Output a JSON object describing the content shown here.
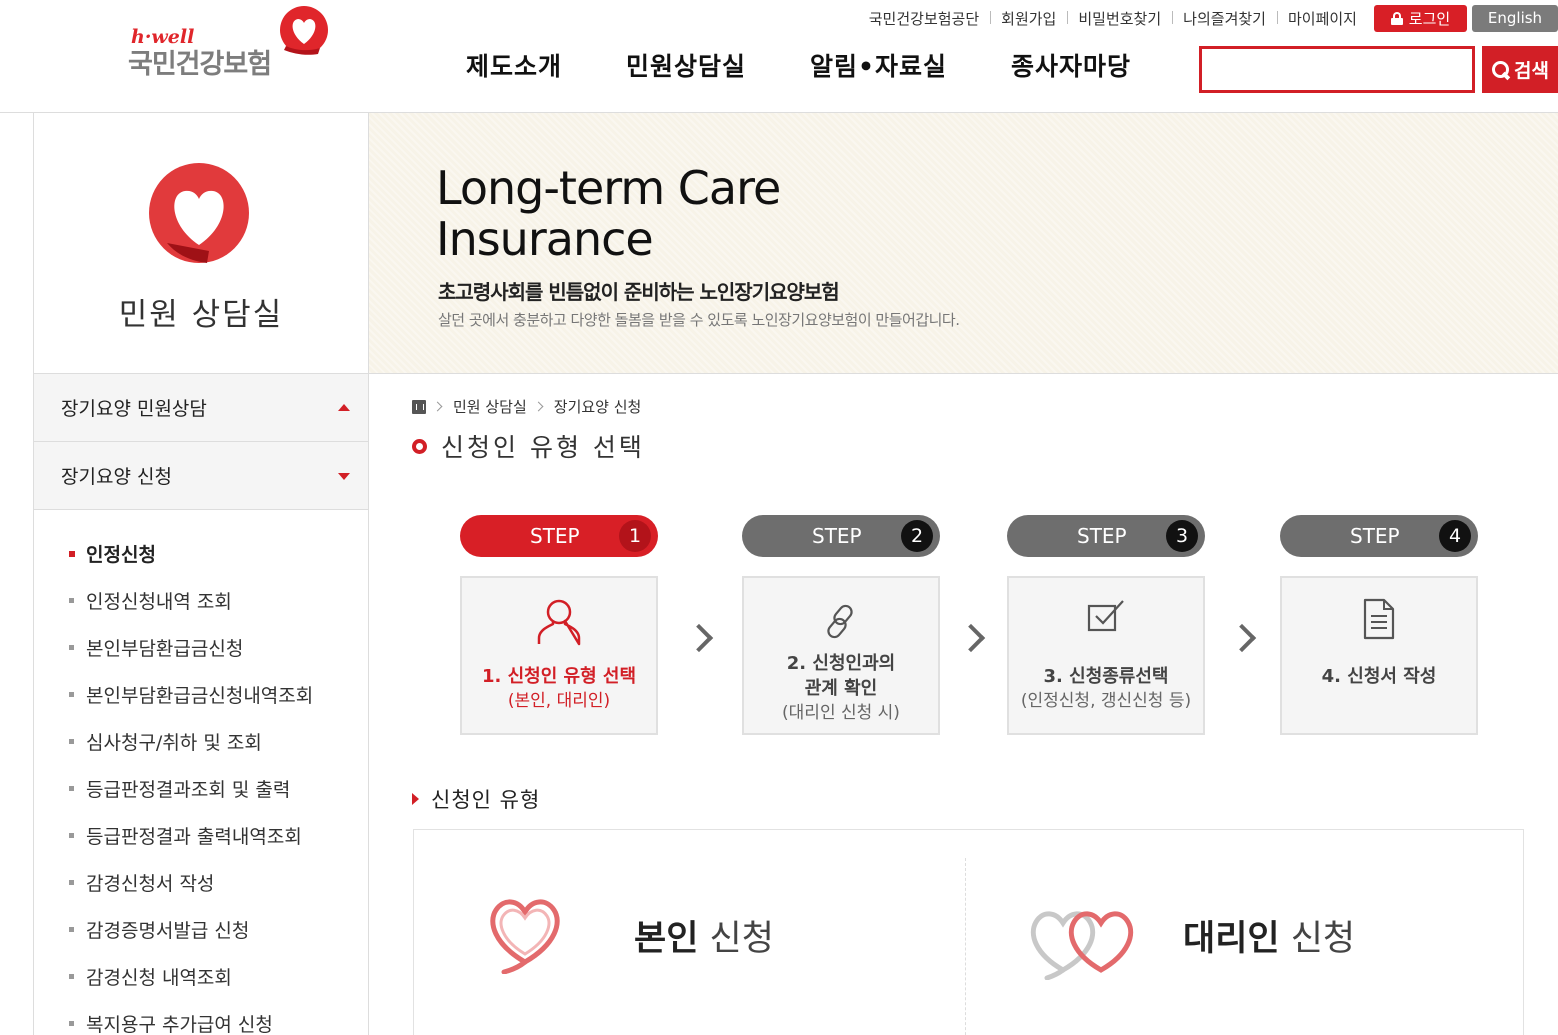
{
  "header": {
    "logo_brand": "h·well",
    "logo_name": "국민건강보험",
    "util_links": [
      "국민건강보험공단",
      "회원가입",
      "비밀번호찾기",
      "나의즐겨찾기",
      "마이페이지"
    ],
    "login_label": "로그인",
    "english_label": "English",
    "gnb": [
      "제도소개",
      "민원상담실",
      "알림•자료실",
      "종사자마당"
    ],
    "search_value": "",
    "search_label": "검색"
  },
  "sidebar": {
    "title": "민원 상담실",
    "menus": [
      {
        "label": "장기요양 민원상담",
        "state": "collapsed"
      },
      {
        "label": "장기요양 신청",
        "state": "expanded"
      }
    ],
    "sub_items": [
      {
        "label": "인정신청",
        "active": true
      },
      {
        "label": "인정신청내역 조회"
      },
      {
        "label": "본인부담환급금신청"
      },
      {
        "label": "본인부담환급금신청내역조회"
      },
      {
        "label": "심사청구/취하 및 조회"
      },
      {
        "label": "등급판정결과조회 및 출력"
      },
      {
        "label": "등급판정결과 출력내역조회"
      },
      {
        "label": "감경신청서 작성"
      },
      {
        "label": "감경증명서발급 신청"
      },
      {
        "label": "감경신청 내역조회"
      },
      {
        "label": "복지용구 추가급여 신청"
      }
    ]
  },
  "banner": {
    "title_line1": "Long-term Care",
    "title_line2": "Insurance",
    "subtitle": "초고령사회를 빈틈없이 준비하는 노인장기요양보험",
    "description": "살던 곳에서 충분하고 다양한 돌봄을 받을 수 있도록 노인장기요양보험이 만들어갑니다."
  },
  "breadcrumb": [
    "민원 상담실",
    "장기요양 신청"
  ],
  "page_title": "신청인 유형 선택",
  "steps": [
    {
      "label": "STEP",
      "num": "1",
      "line1": "1. 신청인 유형 선택",
      "line2": "(본인, 대리인)",
      "active": true,
      "icon": "person-icon"
    },
    {
      "label": "STEP",
      "num": "2",
      "line1a": "2. 신청인과의",
      "line1b": "관계 확인",
      "line2": "(대리인 신청 시)",
      "icon": "link-icon"
    },
    {
      "label": "STEP",
      "num": "3",
      "line1": "3. 신청종류선택",
      "line2": "(인정신청, 갱신신청 등)",
      "icon": "checkbox-icon"
    },
    {
      "label": "STEP",
      "num": "4",
      "line1": "4. 신청서 작성",
      "icon": "document-icon"
    }
  ],
  "section_title": "신청인 유형",
  "applicant_types": [
    {
      "bold": "본인",
      "rest": " 신청",
      "icon": "single-heart-icon"
    },
    {
      "bold": "대리인",
      "rest": " 신청",
      "icon": "double-heart-icon"
    }
  ],
  "colors": {
    "accent": "#d21f26",
    "step_inactive": "#6e6e6e",
    "banner_bg": "#f7f3e8"
  }
}
